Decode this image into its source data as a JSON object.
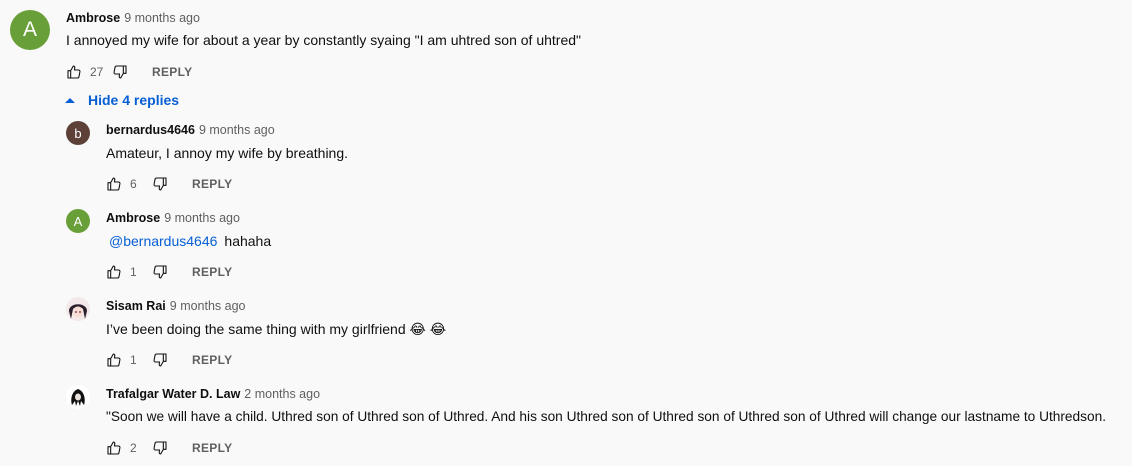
{
  "top_comment": {
    "avatar_letter": "A",
    "avatar_color": "#689f38",
    "author": "Ambrose",
    "time": "9 months ago",
    "text": "I annoyed my wife for about a year by constantly syaing \"I am uhtred son of uhtred\"",
    "likes": "27",
    "reply_label": "REPLY"
  },
  "replies_toggle": {
    "label": "Hide 4 replies",
    "icon": "caret-up-icon"
  },
  "replies": [
    {
      "avatar_letter": "b",
      "avatar_color": "#5d4037",
      "author": "bernardus4646",
      "time": "9 months ago",
      "text": "Amateur, I annoy my wife by breathing.",
      "likes": "6",
      "reply_label": "REPLY"
    },
    {
      "avatar_letter": "A",
      "avatar_color": "#689f38",
      "author": "Ambrose",
      "time": "9 months ago",
      "mention": "@bernardus4646",
      "text": "hahaha",
      "likes": "1",
      "reply_label": "REPLY"
    },
    {
      "avatar_icon": "anime-girl-avatar",
      "author": "Sisam Rai",
      "time": "9 months ago",
      "text": "I’ve been doing the same thing with my girlfriend 😂 😂",
      "likes": "1",
      "reply_label": "REPLY"
    },
    {
      "avatar_icon": "anime-character-avatar",
      "author": "Trafalgar Water D. Law",
      "time": "2 months ago",
      "text": "\"Soon we will have a child. Uthred son of Uthred son of Uthred. And his son Uthred son of Uthred son of Uthred son of Uthred will change our lastname to Uthredson.",
      "likes": "2",
      "reply_label": "REPLY"
    }
  ]
}
